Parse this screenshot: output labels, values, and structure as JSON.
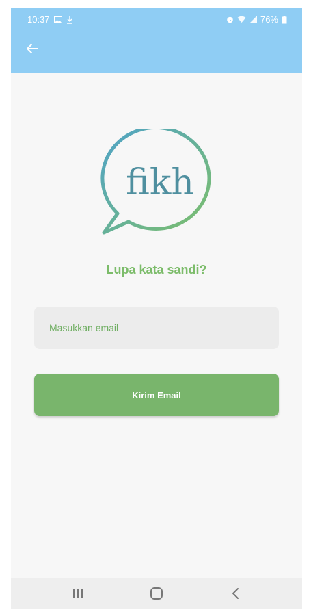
{
  "status_bar": {
    "time": "10:37",
    "battery": "76%",
    "left_icons": [
      "image-icon",
      "download-icon"
    ],
    "right_icons": [
      "alarm-icon",
      "wifi-icon",
      "signal-icon",
      "battery-icon"
    ]
  },
  "app_bar": {
    "color": "#8fcdf4",
    "back_icon": "arrow-left-icon"
  },
  "logo": {
    "text": "fikh",
    "ring_gradient": [
      "#4fa3c9",
      "#7dbf6a"
    ]
  },
  "form": {
    "title": "Lupa kata sandi?",
    "email_placeholder": "Masukkan email",
    "email_value": "",
    "submit_label": "Kirim Email",
    "accent_color": "#79b56c"
  },
  "nav_bar": {
    "buttons": [
      "recents-icon",
      "home-icon",
      "back-chevron-icon"
    ]
  }
}
